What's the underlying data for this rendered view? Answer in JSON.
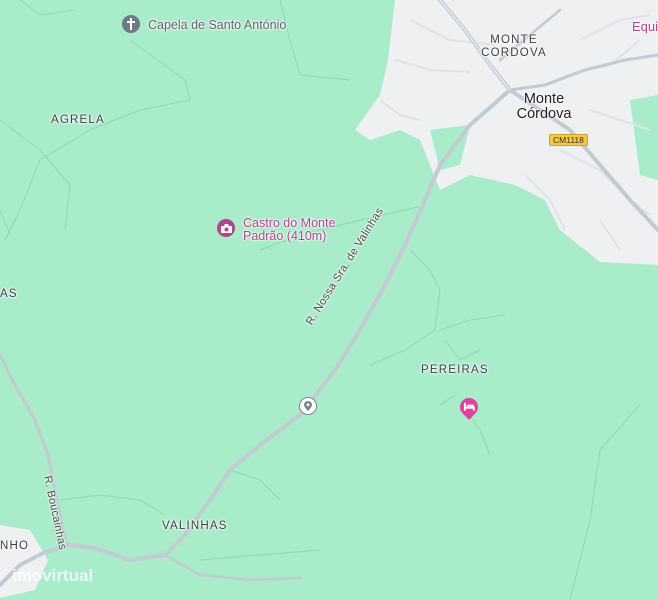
{
  "labels": {
    "agrela": "AGRELA",
    "monte_cordova_area": "MONTE CORDOVA",
    "monte_cordova_town": "Monte Córdova",
    "pereiras": "PEREIRAS",
    "valinhas": "VALINHAS",
    "left_edge_as": "AS",
    "left_edge_nho": "NHO",
    "right_edge_equi": "Equi"
  },
  "pois": {
    "capela": "Capela de Santo António",
    "castro": "Castro do Monte Padrão (410m)"
  },
  "roads": {
    "nossa_sra": "R. Nossa Sra. de Valinhas",
    "boucainhas": "R. Boucainhas",
    "cm_shield": "CM1118"
  },
  "icons": {
    "chapel": "cross-icon",
    "castro": "camera-icon",
    "hotel": "bed-icon",
    "pin": "location-pin-icon"
  },
  "colors": {
    "forest": "#a8ecc9",
    "urban": "#eef0f2",
    "road": "#c2cad2",
    "attraction": "#b0468c",
    "hotel": "#e040a0"
  },
  "watermark": "imovirtual"
}
